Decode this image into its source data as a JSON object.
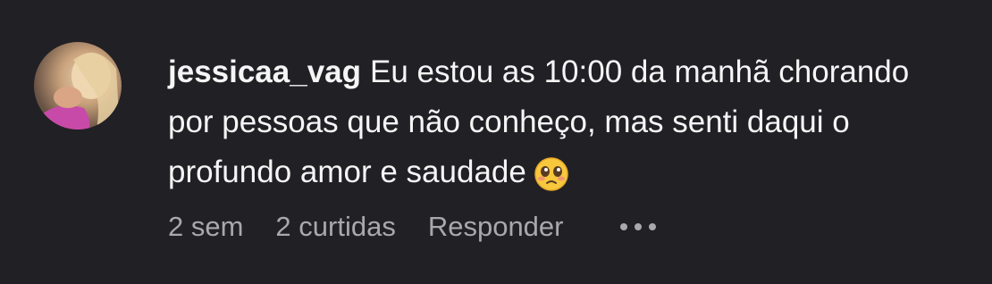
{
  "comment": {
    "username": "jessicaa_vag",
    "text": "Eu estou as 10:00 da manhã chorando por pessoas que não conheço, mas senti daqui o profundo amor e saudade",
    "emoji_icon": "pleading-face-emoji",
    "time": "2 sem",
    "likes": "2 curtidas",
    "reply_label": "Responder",
    "more_icon": "more-options-icon"
  }
}
